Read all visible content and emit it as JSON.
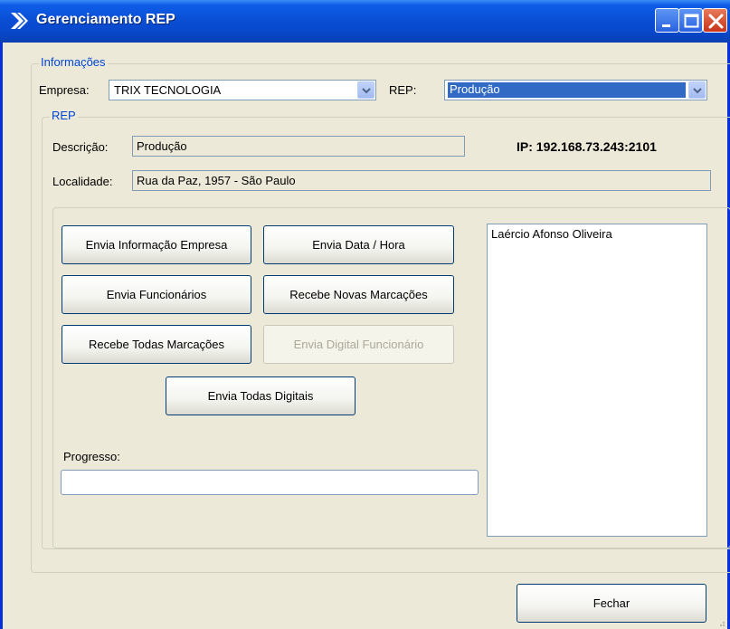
{
  "window": {
    "title": "Gerenciamento REP",
    "buttons": [
      "minimize",
      "maximize",
      "close"
    ]
  },
  "informacoes": {
    "legend": "Informações",
    "empresa_label": "Empresa:",
    "empresa_value": "TRIX TECNOLOGIA",
    "rep_label": "REP:",
    "rep_value": "Produção"
  },
  "rep": {
    "legend": "REP",
    "descricao_label": "Descrição:",
    "descricao_value": "Produção",
    "ip_text": "IP: 192.168.73.243:2101",
    "localidade_label": "Localidade:",
    "localidade_value": "Rua da Paz, 1957 - São Paulo"
  },
  "actions": {
    "envia_info_empresa": "Envia Informação Empresa",
    "envia_data_hora": "Envia Data / Hora",
    "envia_funcionarios": "Envia Funcionários",
    "recebe_novas_marcacoes": "Recebe Novas Marcações",
    "recebe_todas_marcacoes": "Recebe Todas Marcações",
    "envia_digital_funcionario": "Envia Digital Funcionário",
    "envia_todas_digitais": "Envia Todas Digitais"
  },
  "progress": {
    "label": "Progresso:",
    "value": 0
  },
  "employees": {
    "items": [
      "Laércio Afonso Oliveira"
    ]
  },
  "footer": {
    "fechar_label": "Fechar"
  },
  "colors": {
    "titlebar": "#0a4fd6",
    "legend": "#0046d5",
    "selection": "#316ac5",
    "window_bg": "#ece9d8"
  }
}
